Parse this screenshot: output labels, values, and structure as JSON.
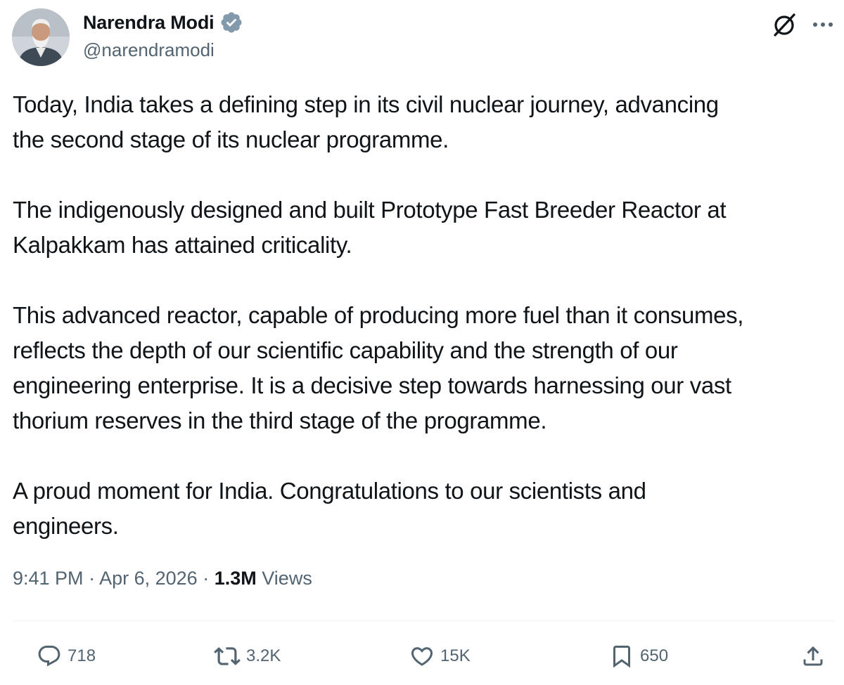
{
  "author": {
    "display_name": "Narendra Modi",
    "handle": "@narendramodi",
    "verified": true,
    "verified_color": "#829aab"
  },
  "tweet": {
    "paragraphs": [
      [
        "Today, India takes a defining step in its civil nuclear journey, advancing",
        "the second stage of its nuclear programme."
      ],
      [
        "The indigenously designed and built Prototype Fast Breeder Reactor at",
        "Kalpakkam has attained criticality."
      ],
      [
        "This advanced reactor, capable of producing more fuel than it consumes,",
        "reflects the depth of our scientific capability and the strength of our",
        "engineering enterprise. It is a decisive step towards harnessing our vast",
        "thorium reserves in the third stage of the programme."
      ],
      [
        "A proud moment for India. Congratulations to our scientists and",
        "engineers."
      ]
    ]
  },
  "meta": {
    "time": "9:41 PM",
    "separator": "·",
    "date": "Apr 6, 2026",
    "views_count": "1.3M",
    "views_label": "Views"
  },
  "actions": {
    "reply_count": "718",
    "repost_count": "3.2K",
    "like_count": "15K",
    "bookmark_count": "650"
  },
  "icons": {
    "avatar": "profile-photo",
    "verified": "verified-badge-icon",
    "grok": "grok-icon",
    "more": "more-icon",
    "reply": "reply-icon",
    "repost": "repost-icon",
    "like": "heart-icon",
    "bookmark": "bookmark-icon",
    "share": "share-icon"
  },
  "colors": {
    "text": "#0f1419",
    "secondary": "#536471",
    "divider": "#eff3f4"
  }
}
